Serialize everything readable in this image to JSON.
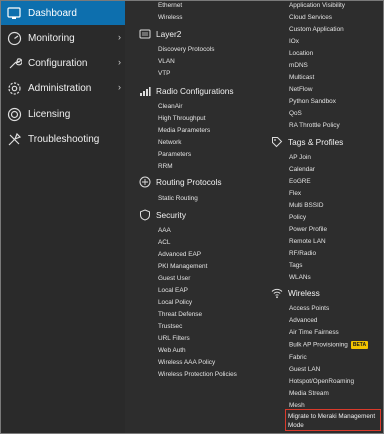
{
  "nav": {
    "items": [
      {
        "label": "Dashboard",
        "icon": "dashboard-icon",
        "active": true
      },
      {
        "label": "Monitoring",
        "icon": "monitoring-icon",
        "chevron": "›"
      },
      {
        "label": "Configuration",
        "icon": "configuration-icon",
        "chevron": "›"
      },
      {
        "label": "Administration",
        "icon": "administration-icon",
        "chevron": "›"
      },
      {
        "label": "Licensing",
        "icon": "licensing-icon"
      },
      {
        "label": "Troubleshooting",
        "icon": "troubleshooting-icon"
      }
    ],
    "active_color": "#0d6fae"
  },
  "col1": {
    "top_links": [
      "Ethernet",
      "Wireless"
    ],
    "layer2": {
      "title": "Layer2",
      "links": [
        "Discovery Protocols",
        "VLAN",
        "VTP"
      ]
    },
    "radio": {
      "title": "Radio Configurations",
      "links": [
        "CleanAir",
        "High Throughput",
        "Media Parameters",
        "Network",
        "Parameters",
        "RRM"
      ]
    },
    "routing": {
      "title": "Routing Protocols",
      "links": [
        "Static Routing"
      ]
    },
    "security": {
      "title": "Security",
      "links": [
        "AAA",
        "ACL",
        "Advanced EAP",
        "PKI Management",
        "Guest User",
        "Local EAP",
        "Local Policy",
        "Threat Defense",
        "Trustsec",
        "URL Filters",
        "Web Auth",
        "Wireless AAA Policy",
        "Wireless Protection Policies"
      ]
    }
  },
  "col2": {
    "top_links": [
      "Application Visibility",
      "Cloud Services",
      "Custom Application",
      "IOx",
      "Location",
      "mDNS",
      "Multicast",
      "NetFlow",
      "Python Sandbox",
      "QoS",
      "RA Throttle Policy"
    ],
    "tags": {
      "title": "Tags & Profiles",
      "links": [
        "AP Join",
        "Calendar",
        "EoGRE",
        "Flex",
        "Multi BSSID",
        "Policy",
        "Power Profile",
        "Remote LAN",
        "RF/Radio",
        "Tags",
        "WLANs"
      ]
    },
    "wireless": {
      "title": "Wireless",
      "links": [
        "Access Points",
        "Advanced",
        "Air Time Fairness",
        "Bulk AP Provisioning",
        "Fabric",
        "Guest LAN",
        "Hotspot/OpenRoaming",
        "Media Stream",
        "Mesh"
      ],
      "beta_label": "BETA",
      "highlight_line1": "Migrate to Meraki Management",
      "highlight_line2": "Mode",
      "highlight_color": "#d93a2b"
    }
  }
}
